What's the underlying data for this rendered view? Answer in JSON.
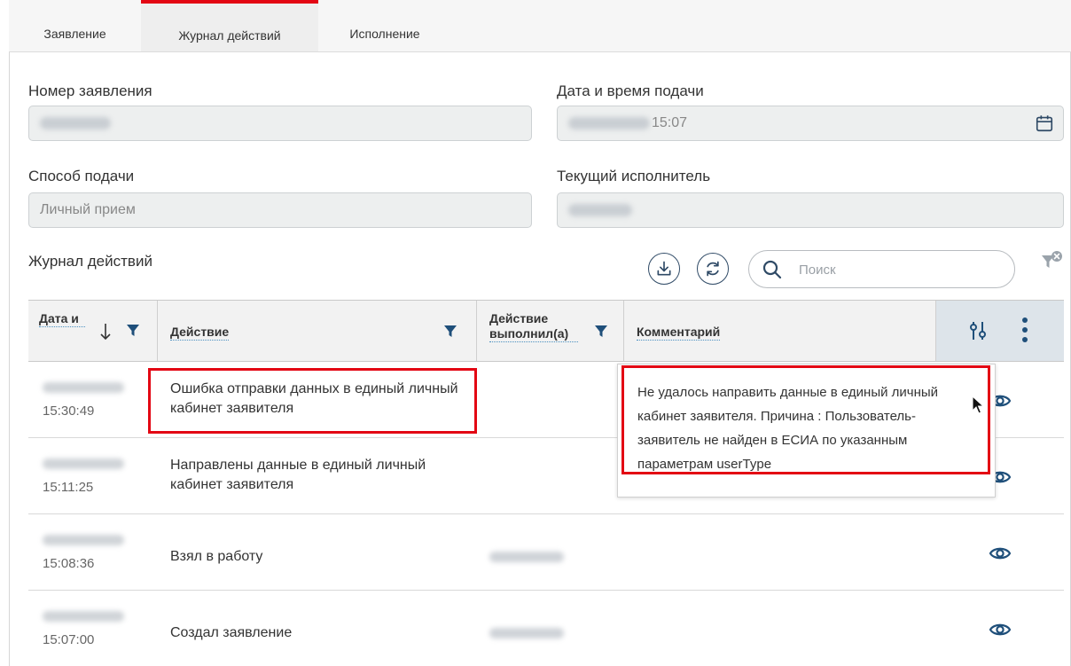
{
  "tabs": [
    {
      "label": "Заявление",
      "active": false
    },
    {
      "label": "Журнал действий",
      "active": true
    },
    {
      "label": "Исполнение",
      "active": false
    }
  ],
  "form": {
    "number_label": "Номер заявления",
    "date_label": "Дата и времи подачи",
    "date_time_visible": "15:07",
    "method_label": "Способ подачи",
    "method_value": "Личный прием",
    "executor_label": "Текущий исполнитель"
  },
  "journal": {
    "title": "Журнал действий",
    "search_placeholder": "Поиск",
    "columns": {
      "date": "Дата и",
      "action": "Действие",
      "actor": "Действие выполнил(а)",
      "comment": "Комментарий"
    },
    "rows": [
      {
        "time": "15:30:49",
        "action": "Ошибка отправки данных в единый личный кабинет заявителя"
      },
      {
        "time": "15:11:25",
        "action": "Направлены данные в единый личный кабинет заявителя"
      },
      {
        "time": "15:08:36",
        "action": "Взял в работу"
      },
      {
        "time": "15:07:00",
        "action": "Создал заявление"
      }
    ],
    "tooltip": "Не удалось направить данные в единый личный кабинет заявителя. Причина : Пользователь-заявитель не найден в ЕСИА по указанным параметрам userType"
  },
  "colors": {
    "accent_red": "#e30613",
    "icon_navy": "#2f4a66",
    "eye_blue": "#1f4f7a"
  }
}
